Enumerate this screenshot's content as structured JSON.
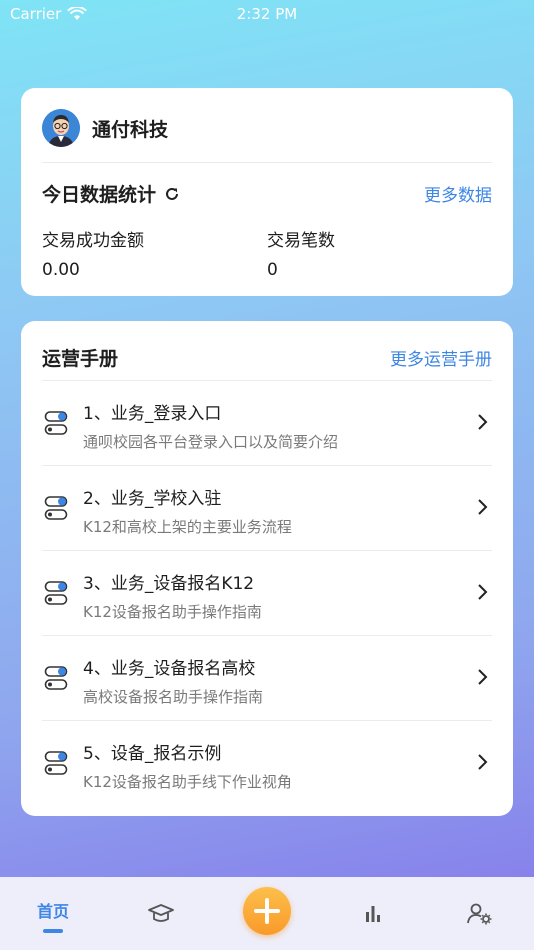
{
  "status_bar": {
    "carrier": "Carrier",
    "time": "2:32 PM"
  },
  "company": {
    "name": "通付科技"
  },
  "stats": {
    "title": "今日数据统计",
    "more_label": "更多数据",
    "items": [
      {
        "label": "交易成功金额",
        "value": "0.00"
      },
      {
        "label": "交易笔数",
        "value": "0"
      }
    ]
  },
  "manual": {
    "title": "运营手册",
    "more_label": "更多运营手册",
    "items": [
      {
        "title": "1、业务_登录入口",
        "desc": "通呗校园各平台登录入口以及简要介绍"
      },
      {
        "title": "2、业务_学校入驻",
        "desc": "K12和高校上架的主要业务流程"
      },
      {
        "title": "3、业务_设备报名K12",
        "desc": "K12设备报名助手操作指南"
      },
      {
        "title": "4、业务_设备报名高校",
        "desc": "高校设备报名助手操作指南"
      },
      {
        "title": "5、设备_报名示例",
        "desc": "K12设备报名助手线下作业视角"
      }
    ]
  },
  "tabbar": {
    "home_label": "首页",
    "accent": "#3d86e6",
    "icons": [
      "graduation-cap-icon",
      "add-icon",
      "bar-chart-icon",
      "user-settings-icon"
    ]
  }
}
